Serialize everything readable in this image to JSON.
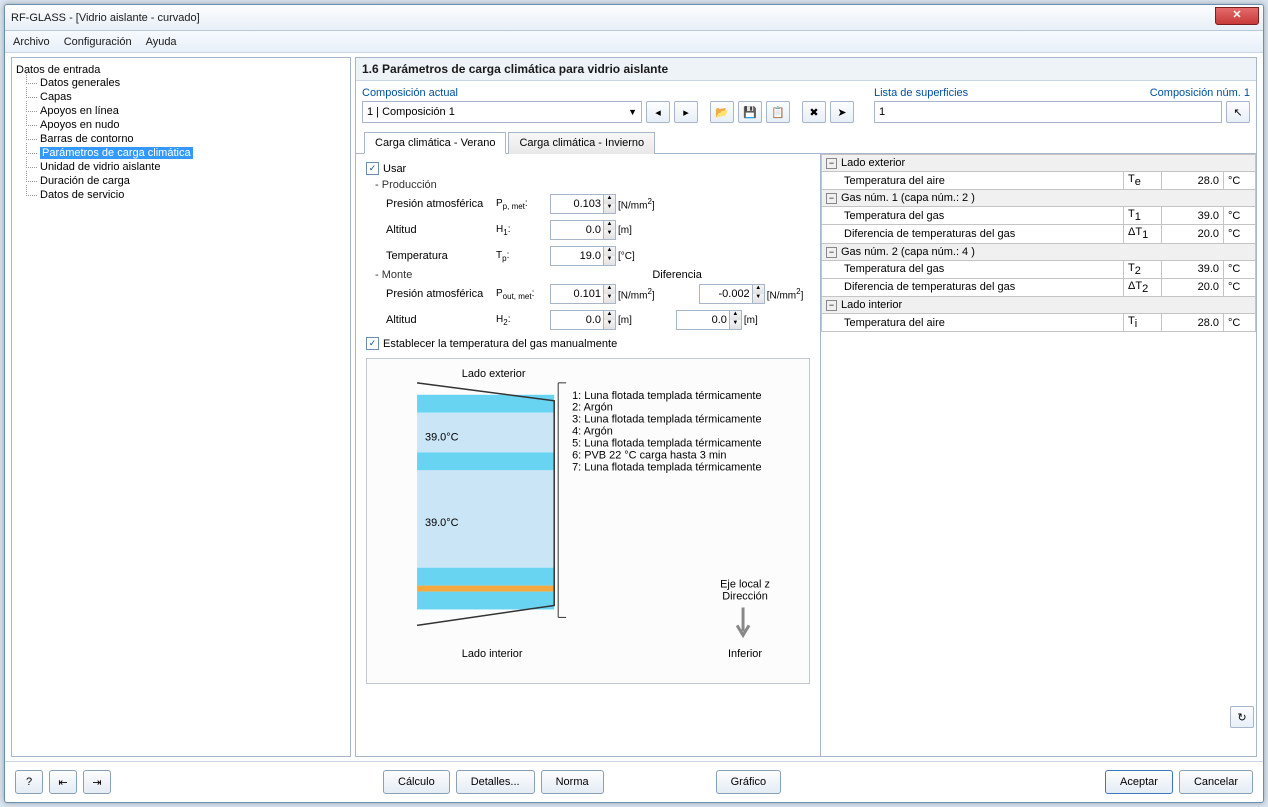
{
  "title": "RF-GLASS - [Vidrio aislante - curvado]",
  "menu": {
    "file": "Archivo",
    "config": "Configuración",
    "help": "Ayuda"
  },
  "tree": {
    "root": "Datos de entrada",
    "items": [
      "Datos generales",
      "Capas",
      "Apoyos en línea",
      "Apoyos en nudo",
      "Barras de contorno",
      "Parámetros de carga climática",
      "Unidad de vidrio aislante",
      "Duración de carga",
      "Datos de servicio"
    ],
    "selectedIndex": 5
  },
  "heading": "1.6 Parámetros de carga climática para vidrio aislante",
  "comp": {
    "label": "Composición actual",
    "value": "1 | Composición 1"
  },
  "surf": {
    "label": "Lista de superficies",
    "value": "1",
    "numlabel": "Composición núm. 1"
  },
  "tabs": {
    "summer": "Carga climática - Verano",
    "winter": "Carga climática - Invierno"
  },
  "form": {
    "use": "Usar",
    "production": "Producción",
    "monte": "Monte",
    "diff": "Diferencia",
    "p_atm": "Presión atmosférica",
    "altitude": "Altitud",
    "temperature": "Temperatura",
    "setgas": "Establecer la temperatura del gas manualmente",
    "pp": "0.103",
    "h1": "0.0",
    "tp": "19.0",
    "pout": "0.101",
    "h2": "0.0",
    "dp": "-0.002",
    "dh": "0.0"
  },
  "diagram": {
    "outer": "Lado exterior",
    "inner": "Lado interior",
    "t1": "39.0°C",
    "t2": "39.0°C",
    "layers": [
      "1: Luna flotada templada térmicamente",
      "2: Argón",
      "3: Luna flotada templada térmicamente",
      "4: Argón",
      "5: Luna flotada templada térmicamente",
      "6: PVB 22 °C carga hasta 3 min",
      "7: Luna flotada templada térmicamente"
    ],
    "axis1": "Eje local z",
    "axis2": "Dirección",
    "axis3": "Inferior"
  },
  "props": {
    "ext": "Lado exterior",
    "airtemp": "Temperatura del aire",
    "gas1": "Gas núm. 1 (capa núm.: 2 )",
    "gastemp": "Temperatura del gas",
    "gasdiff": "Diferencia de temperaturas del gas",
    "gas2": "Gas núm. 2 (capa núm.: 4 )",
    "int": "Lado interior",
    "te": "28.0",
    "t1": "39.0",
    "dt1": "20.0",
    "t2": "39.0",
    "dt2": "20.0",
    "ti": "28.0"
  },
  "buttons": {
    "calc": "Cálculo",
    "details": "Detalles...",
    "norm": "Norma",
    "graph": "Gráfico",
    "ok": "Aceptar",
    "cancel": "Cancelar"
  }
}
